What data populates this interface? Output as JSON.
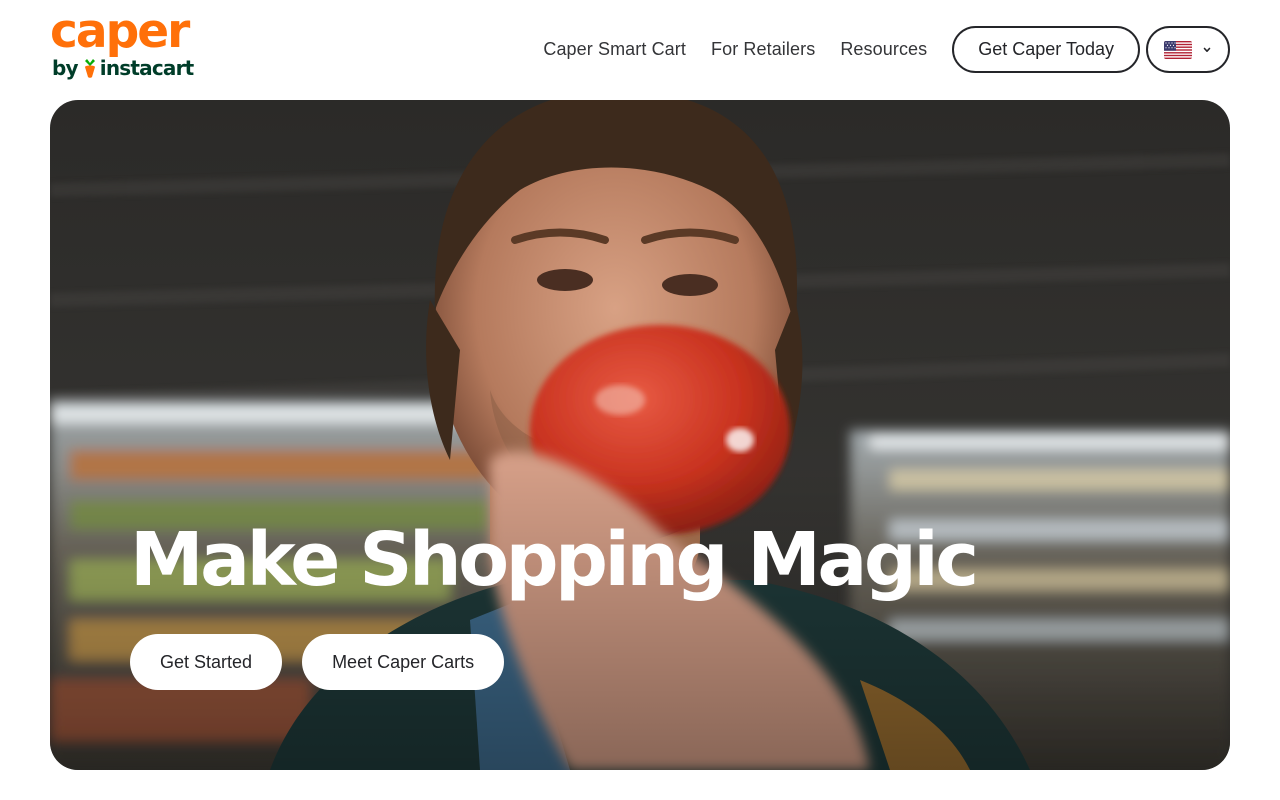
{
  "brand": {
    "logo_word": "caper",
    "logo_by": "by",
    "logo_partner": "instacart",
    "primary_color": "#FF7009",
    "partner_color": "#003D29",
    "carrot_leaf_color": "#0AAD0A"
  },
  "nav": {
    "links": [
      "Caper Smart Cart",
      "For Retailers",
      "Resources"
    ],
    "cta_label": "Get Caper Today",
    "locale_icon": "us-flag-icon"
  },
  "hero": {
    "title": "Make Shopping Magic",
    "buttons": [
      "Get Started",
      "Meet Caper Carts"
    ],
    "image": "man holding a tomato in a grocery store aisle"
  }
}
